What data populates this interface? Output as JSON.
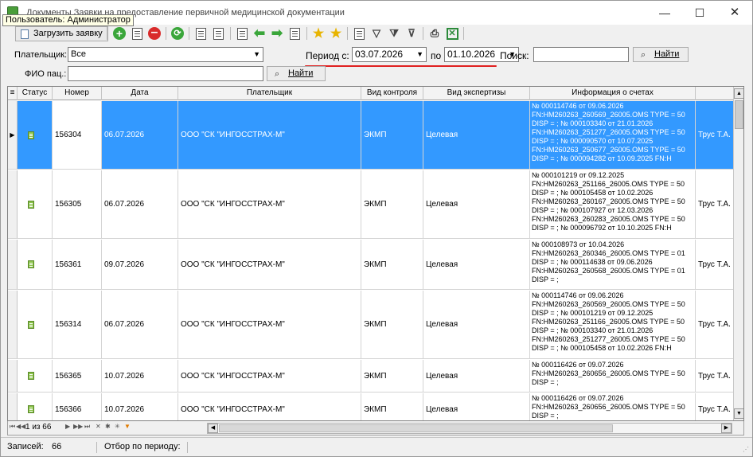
{
  "window": {
    "title": "Документы Заявки на предоставление первичной медицинской документации",
    "minimize_icon": "minimize-icon",
    "maximize_icon": "maximize-icon",
    "close_icon": "close-icon"
  },
  "tooltip": "Пользователь: Администратор",
  "toolbar": {
    "load_label": "Загрузить заявку"
  },
  "filters": {
    "payer_label": "Плательщик:",
    "payer_value": "Все",
    "period_label": "Период с:",
    "period_from": "03.07.2026",
    "period_to_label": "по",
    "period_to": "01.10.2026",
    "search_label": "Поиск:",
    "search_value": "",
    "find_label": "Найти",
    "fio_label": "ФИО пац.:",
    "fio_value": "",
    "find2_label": "Найти",
    "highlight_color": "#e02020"
  },
  "grid": {
    "columns": [
      "Статус",
      "Номер",
      "Дата",
      "Плательщик",
      "Вид контроля",
      "Вид экспертизы",
      "Информация о счетах",
      ""
    ],
    "rows": [
      {
        "number": "156304",
        "date": "06.07.2026",
        "payer": "ООО \"СК \"ИНГОССТРАХ-М\"",
        "control": "ЭКМП",
        "expertise": "Целевая",
        "info": [
          "№ 000114746 от 09.06.2026",
          "FN:HM260263_260569_26005.OMS TYPE = 50",
          "DISP = ;  № 000103340 от 21.01.2026",
          "FN:HM260263_251277_26005.OMS TYPE = 50",
          "DISP = ;  № 000090570 от 10.07.2025",
          "FN:HM260263_250677_26005.OMS TYPE = 50",
          "DISP = ;  № 000094282 от 10.09.2025 FN:H"
        ],
        "expert": "Трус Т.А.",
        "selected": true
      },
      {
        "number": "156305",
        "date": "06.07.2026",
        "payer": "ООО \"СК \"ИНГОССТРАХ-М\"",
        "control": "ЭКМП",
        "expertise": "Целевая",
        "info": [
          "№ 000101219 от 09.12.2025",
          "FN:HM260263_251166_26005.OMS TYPE = 50",
          "DISP = ;  № 000105458 от 10.02.2026",
          "FN:HM260263_260167_26005.OMS TYPE = 50",
          "DISP = ;  № 000107927 от 12.03.2026",
          "FN:HM260263_260283_26005.OMS TYPE = 50",
          "DISP = ;  № 000096792 от 10.10.2025 FN:H"
        ],
        "expert": "Трус Т.А.",
        "selected": false
      },
      {
        "number": "156361",
        "date": "09.07.2026",
        "payer": "ООО \"СК \"ИНГОССТРАХ-М\"",
        "control": "ЭКМП",
        "expertise": "Целевая",
        "info": [
          "№ 000108973 от 10.04.2026",
          "FN:HM260263_260346_26005.OMS TYPE = 01",
          "DISP = ;  № 000114638 от 09.06.2026",
          "FN:HM260263_260568_26005.OMS TYPE = 01",
          "DISP = ;"
        ],
        "expert": "Трус Т.А.",
        "selected": false
      },
      {
        "number": "156314",
        "date": "06.07.2026",
        "payer": "ООО \"СК \"ИНГОССТРАХ-М\"",
        "control": "ЭКМП",
        "expertise": "Целевая",
        "info": [
          "№ 000114746 от 09.06.2026",
          "FN:HM260263_260569_26005.OMS TYPE = 50",
          "DISP = ;  № 000101219 от 09.12.2025",
          "FN:HM260263_251166_26005.OMS TYPE = 50",
          "DISP = ;  № 000103340 от 21.01.2026",
          "FN:HM260263_251277_26005.OMS TYPE = 50",
          "DISP = ;  № 000105458 от 10.02.2026 FN:H"
        ],
        "expert": "Трус Т.А.",
        "selected": false
      },
      {
        "number": "156365",
        "date": "10.07.2026",
        "payer": "ООО \"СК \"ИНГОССТРАХ-М\"",
        "control": "ЭКМП",
        "expertise": "Целевая",
        "info": [
          "№ 000116426 от 09.07.2026",
          "FN:HM260263_260656_26005.OMS TYPE = 50",
          "DISP = ;"
        ],
        "expert": "Трус Т.А.",
        "selected": false
      },
      {
        "number": "156366",
        "date": "10.07.2026",
        "payer": "ООО \"СК \"ИНГОССТРАХ-М\"",
        "control": "ЭКМП",
        "expertise": "Целевая",
        "info": [
          "№ 000116426 от 09.07.2026",
          "FN:HM260263_260656_26005.OMS TYPE = 50",
          "DISP = ;"
        ],
        "expert": "Трус Т.А.",
        "selected": false
      }
    ]
  },
  "navigator": {
    "position_text": "1 из 66"
  },
  "statusbar": {
    "records_label": "Записей:",
    "records_count": "66",
    "period_filter_label": "Отбор по периоду:"
  }
}
